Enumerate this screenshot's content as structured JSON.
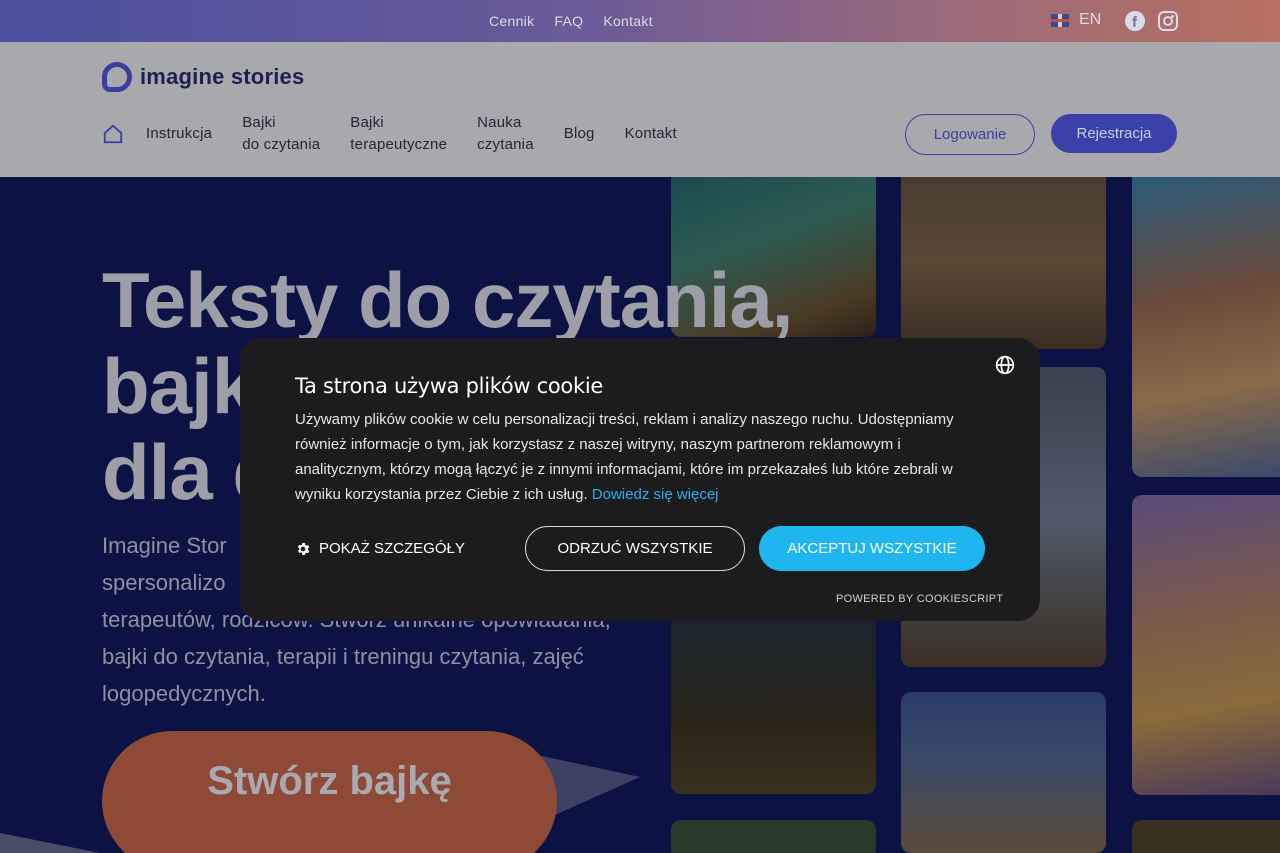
{
  "topbar": {
    "links": [
      "Cennik",
      "FAQ",
      "Kontakt"
    ],
    "language": "EN"
  },
  "header": {
    "logo_text": "imagine stories",
    "nav": [
      {
        "line1": "Instrukcja",
        "line2": ""
      },
      {
        "line1": "Bajki",
        "line2": "do czytania"
      },
      {
        "line1": "Bajki",
        "line2": "terapeutyczne"
      },
      {
        "line1": "Nauka",
        "line2": "czytania"
      },
      {
        "line1": "Blog",
        "line2": ""
      },
      {
        "line1": "Kontakt",
        "line2": ""
      }
    ],
    "login_label": "Logowanie",
    "register_label": "Rejestracja"
  },
  "hero": {
    "title_line1": "Teksty do czytania,",
    "title_line2": "bajki",
    "title_line3": "dla d",
    "desc_line1": "Imagine Stor",
    "desc_line2": "spersonalizo",
    "desc_line3": "terapeutów, rodziców. Stwórz unikalne opowiadania,",
    "desc_line4": "bajki do czytania, terapii i treningu czytania, zajęć",
    "desc_line5": "logopedycznych.",
    "cta_label": "Stwórz bajkę"
  },
  "cookie": {
    "title": "Ta strona używa plików cookie",
    "body": "Używamy plików cookie w celu personalizacji treści, reklam i analizy naszego ruchu. Udostępniamy również informacje o tym, jak korzystasz z naszej witryny, naszym partnerom reklamowym i analitycznym, którzy mogą łączyć je z innymi informacjami, które im przekazałeś lub które zebrali w wyniku korzystania przez Ciebie z ich usług.",
    "link_label": "Dowiedz się więcej",
    "details_label": "POKAŻ SZCZEGÓŁY",
    "reject_label": "ODRZUĆ WSZYSTKIE",
    "accept_label": "AKCEPTUJ WSZYSTKIE",
    "powered_label": "POWERED BY COOKIESCRIPT"
  },
  "colors": {
    "accent": "#3b41a8",
    "cookie_accept": "#1fb6f0",
    "cta": "#8e4a36"
  }
}
